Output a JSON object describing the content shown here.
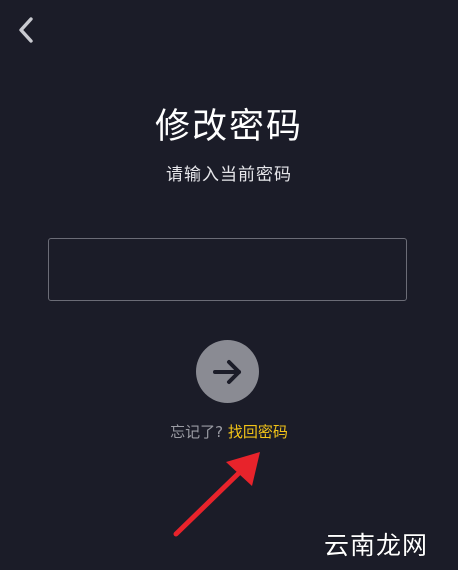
{
  "header": {
    "back_icon": "chevron-left-icon"
  },
  "main": {
    "title": "修改密码",
    "subtitle": "请输入当前密码",
    "password_input": {
      "value": "",
      "placeholder": ""
    },
    "next_icon": "arrow-right-icon",
    "forgot_prefix": "忘记了? ",
    "forgot_link": "找回密码"
  },
  "overlay": {
    "annotation_arrow_color": "#e8232b",
    "watermark": "云南龙网"
  },
  "colors": {
    "background": "#1b1c28",
    "accent": "#f2c318",
    "button": "#8a8b93"
  }
}
